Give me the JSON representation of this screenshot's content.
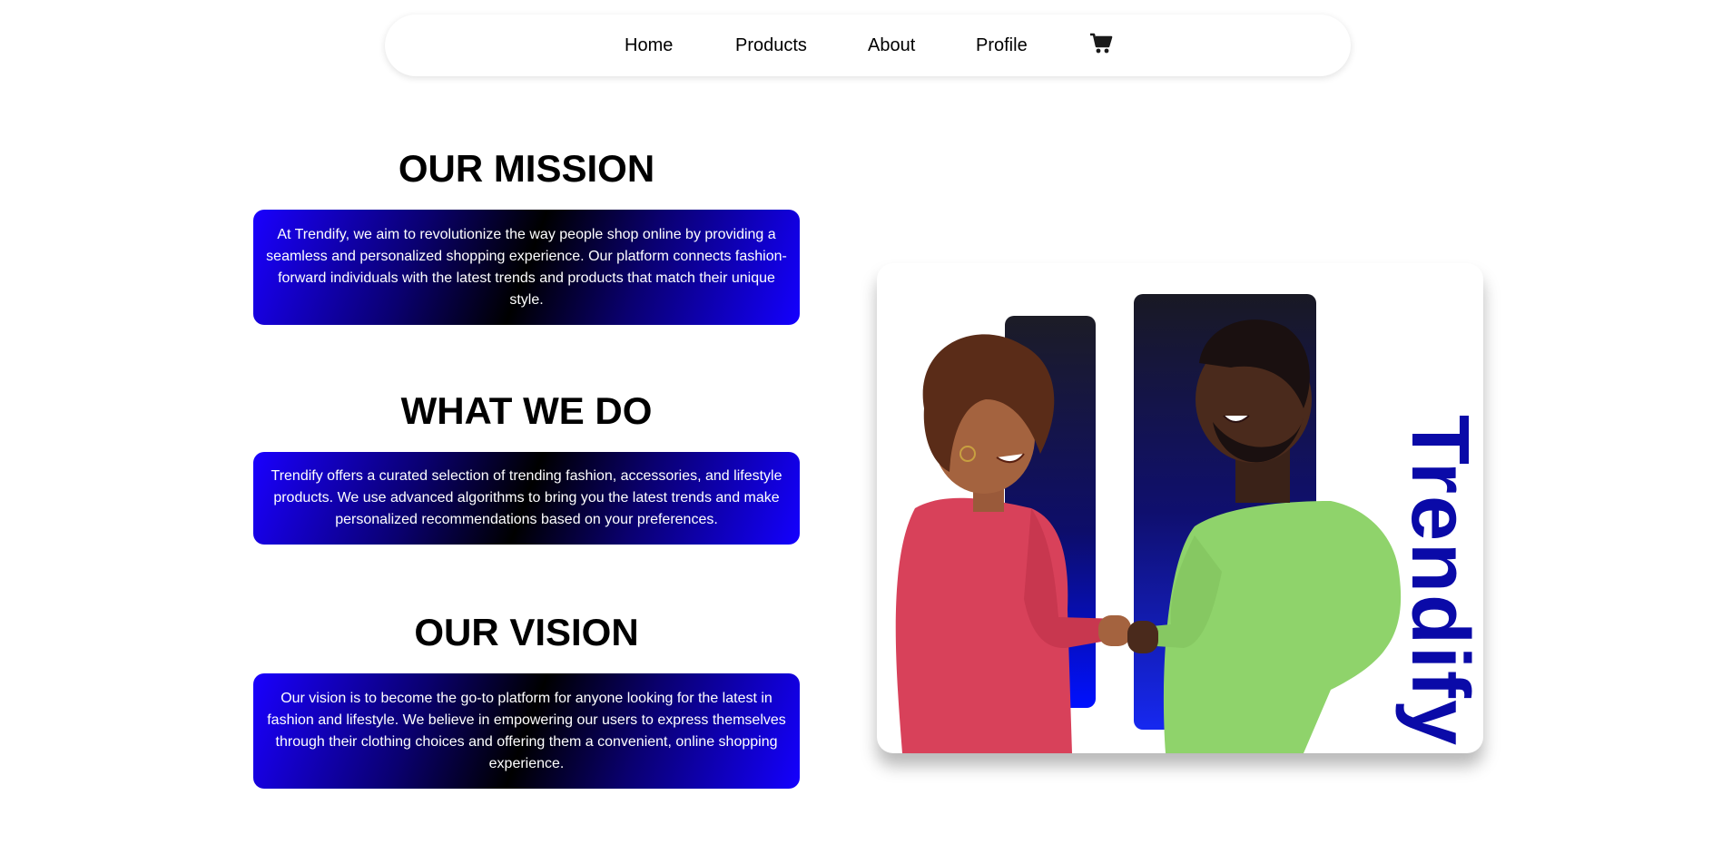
{
  "nav": {
    "items": [
      "Home",
      "Products",
      "About",
      "Profile"
    ],
    "cart_icon": "shopping-cart-icon"
  },
  "sections": [
    {
      "title": "OUR MISSION",
      "body": "At Trendify, we aim to revolutionize the way people shop online by providing a seamless and personalized shopping experience. Our platform connects fashion-forward individuals with the latest trends and products that match their unique style."
    },
    {
      "title": "WHAT WE DO",
      "body": "Trendify offers a curated selection of trending fashion, accessories, and lifestyle products. We use advanced algorithms to bring you the latest trends and make personalized recommendations based on your preferences."
    },
    {
      "title": "OUR VISION",
      "body": "Our vision is to become the go-to platform for anyone looking for the latest in fashion and lifestyle. We believe in empowering our users to express themselves through their clothing choices and offering them a convenient, online shopping experience."
    }
  ],
  "hero": {
    "brand_text": "Trendify"
  },
  "colors": {
    "accent_blue": "#1400ff",
    "brand_text": "#0a0aa8",
    "shirt_left": "#d8415a",
    "shirt_right": "#8fd36b"
  }
}
